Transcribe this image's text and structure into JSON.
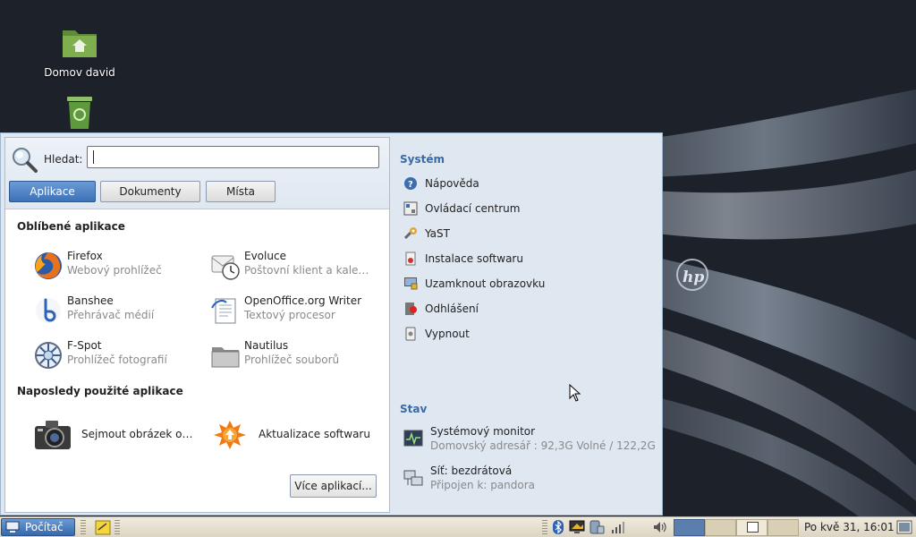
{
  "desktop": {
    "icons": [
      {
        "label": "Domov david",
        "icon": "home-folder-icon"
      },
      {
        "label": "",
        "icon": "trash-icon"
      }
    ],
    "wallpaper_logo": "hp"
  },
  "menu": {
    "search": {
      "label": "Hledat:",
      "value": "",
      "placeholder": ""
    },
    "tabs": [
      {
        "label": "Aplikace",
        "active": true
      },
      {
        "label": "Dokumenty",
        "active": false
      },
      {
        "label": "Místa",
        "active": false
      }
    ],
    "favorites": {
      "title": "Oblíbené aplikace",
      "items": [
        {
          "name": "Firefox",
          "desc": "Webový prohlížeč",
          "icon": "firefox-icon"
        },
        {
          "name": "Evoluce",
          "desc": "Poštovní klient a kale…",
          "icon": "evolution-icon"
        },
        {
          "name": "Banshee",
          "desc": "Přehrávač médií",
          "icon": "banshee-icon"
        },
        {
          "name": "OpenOffice.org Writer",
          "desc": "Textový procesor",
          "icon": "writer-icon"
        },
        {
          "name": "F-Spot",
          "desc": "Prohlížeč fotografií",
          "icon": "fspot-icon"
        },
        {
          "name": "Nautilus",
          "desc": "Prohlížeč souborů",
          "icon": "nautilus-icon"
        }
      ]
    },
    "recent": {
      "title": "Naposledy použité aplikace",
      "items": [
        {
          "name": "Sejmout obrázek o…",
          "icon": "camera-icon"
        },
        {
          "name": "Aktualizace softwaru",
          "icon": "software-update-icon"
        }
      ]
    },
    "more_button": "Více aplikací...",
    "system": {
      "title": "Systém",
      "items": [
        {
          "label": "Nápověda",
          "icon": "help-icon"
        },
        {
          "label": "Ovládací centrum",
          "icon": "control-center-icon"
        },
        {
          "label": "YaST",
          "icon": "yast-icon"
        },
        {
          "label": "Instalace softwaru",
          "icon": "install-software-icon"
        },
        {
          "label": "Uzamknout obrazovku",
          "icon": "lock-screen-icon"
        },
        {
          "label": "Odhlášení",
          "icon": "logout-icon"
        },
        {
          "label": "Vypnout",
          "icon": "shutdown-icon"
        }
      ]
    },
    "status": {
      "title": "Stav",
      "items": [
        {
          "name": "Systémový monitor",
          "desc": "Domovský adresář : 92,3G Volné / 122,2G",
          "icon": "system-monitor-icon"
        },
        {
          "name": "Síť: bezdrátová",
          "desc": "Připojen k: pandora",
          "icon": "network-icon"
        }
      ]
    }
  },
  "taskbar": {
    "start_label": "Počítač",
    "clock": "Po kvě 31, 16:01",
    "colors": {
      "accent": "#3d72b8",
      "panel": "#e6e0cf"
    }
  }
}
